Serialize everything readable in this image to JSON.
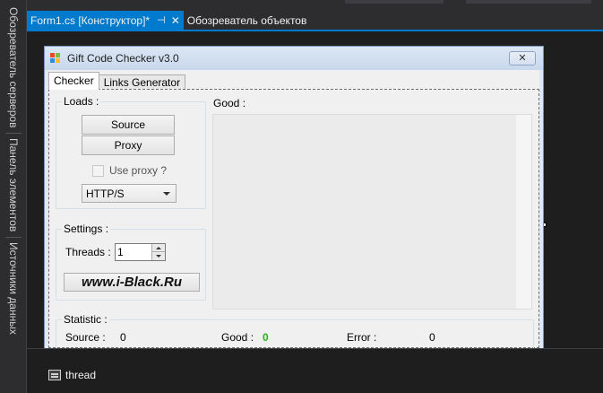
{
  "ide": {
    "side_tabs": [
      "Обозреватель серверов",
      "Панель элементов",
      "Источники данных"
    ],
    "doc_tabs": [
      {
        "label": "Form1.cs [Конструктор]*",
        "pin": "⊣",
        "close": "✕"
      },
      {
        "label": "Обозреватель объектов"
      }
    ],
    "tray": {
      "component_label": "thread"
    }
  },
  "form": {
    "title": "Gift Code Checker v3.0",
    "close_glyph": "✕",
    "tabs": [
      "Checker",
      "Links Generator"
    ],
    "loads": {
      "label": "Loads :",
      "source_button": "Source",
      "proxy_button": "Proxy",
      "use_proxy_label": "Use proxy ?",
      "use_proxy_checked": false,
      "proxy_type": "HTTP/S"
    },
    "settings": {
      "label": "Settings :",
      "threads_label": "Threads :",
      "threads_value": "1",
      "brand_button": "www.i-Black.Ru"
    },
    "good": {
      "label": "Good :"
    },
    "statistic": {
      "label": "Statistic :",
      "source_label": "Source :",
      "source_value": "0",
      "good_label": "Good :",
      "good_value": "0",
      "error_label": "Error :",
      "error_value": "0"
    }
  },
  "colors": {
    "ide_accent": "#007acc",
    "good_value": "#27b11d"
  }
}
